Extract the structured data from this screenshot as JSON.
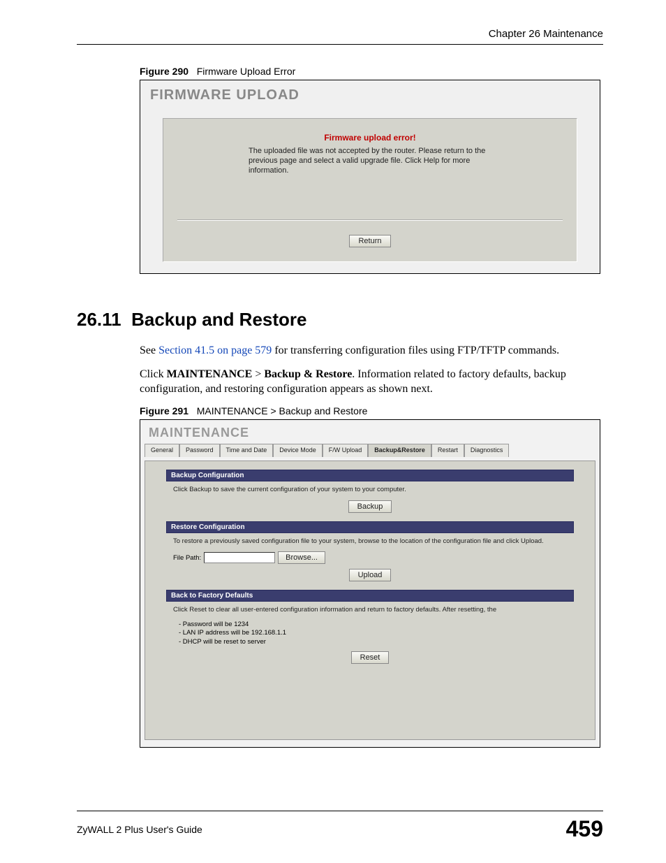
{
  "header": {
    "chapter": "Chapter 26 Maintenance"
  },
  "figure290": {
    "caption_label": "Figure 290",
    "caption_text": "Firmware Upload Error",
    "screen_title": "FIRMWARE UPLOAD",
    "error_heading": "Firmware upload error!",
    "error_message": "The uploaded file was not accepted by the router. Please return to the previous page and select a valid upgrade file. Click Help for more information.",
    "return_btn": "Return"
  },
  "section": {
    "number": "26.11",
    "title": "Backup and Restore",
    "p1_prefix": "See ",
    "p1_link": "Section 41.5 on page 579",
    "p1_suffix": " for transferring configuration files using FTP/TFTP commands.",
    "p2_a": "Click ",
    "p2_b": "MAINTENANCE",
    "p2_c": " > ",
    "p2_d": "Backup & Restore",
    "p2_e": ". Information related to factory defaults, backup configuration, and restoring configuration appears as shown next."
  },
  "figure291": {
    "caption_label": "Figure 291",
    "caption_text": "MAINTENANCE > Backup and Restore",
    "screen_title": "MAINTENANCE",
    "tabs": [
      "General",
      "Password",
      "Time and Date",
      "Device Mode",
      "F/W Upload",
      "Backup&Restore",
      "Restart",
      "Diagnostics"
    ],
    "backup": {
      "bar": "Backup Configuration",
      "text": "Click Backup to save the current configuration of your system to your computer.",
      "btn": "Backup"
    },
    "restore": {
      "bar": "Restore Configuration",
      "text": "To restore a previously saved configuration file to your system, browse to the location of the configuration file and click Upload.",
      "file_label": "File Path:",
      "browse_btn": "Browse...",
      "upload_btn": "Upload"
    },
    "factory": {
      "bar": "Back to Factory Defaults",
      "text": "Click Reset to clear all user-entered configuration information and return to factory defaults. After resetting, the",
      "b1": "- Password will be 1234",
      "b2": "- LAN IP address will be 192.168.1.1",
      "b3": "- DHCP will be reset to server",
      "btn": "Reset"
    }
  },
  "footer": {
    "guide": "ZyWALL 2 Plus User's Guide",
    "page": "459"
  }
}
